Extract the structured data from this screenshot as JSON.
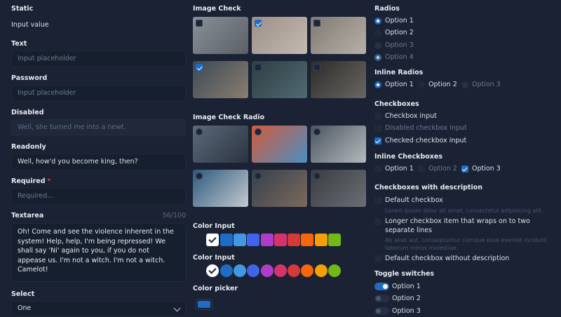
{
  "col1": {
    "static_label": "Static",
    "static_value": "Input value",
    "text_label": "Text",
    "text_placeholder": "Input placeholder",
    "password_label": "Password",
    "password_placeholder": "Input placeholder",
    "disabled_label": "Disabled",
    "disabled_value": "Well, she turned me into a newt.",
    "readonly_label": "Readonly",
    "readonly_value": "Well, how'd you become king, then?",
    "required_label": "Required",
    "required_star": "*",
    "required_placeholder": "Required...",
    "textarea_label": "Textarea",
    "textarea_counter": "56/100",
    "textarea_value": "Oh! Come and see the violence inherent in the system! Help, help, I'm being repressed! We shall say 'Ni' again to you, if you do not appease us. I'm not a witch. I'm not a witch. Camelot!",
    "select_label": "Select",
    "select_value": "One"
  },
  "col2": {
    "image_check_label": "Image Check",
    "image_check_checked": [
      false,
      true,
      false,
      true,
      false,
      false
    ],
    "image_check_colors": [
      [
        "#8a9097",
        "#5a6066"
      ],
      [
        "#9c8f86",
        "#c3bab3"
      ],
      [
        "#7f7a73",
        "#b7b0a7"
      ],
      [
        "#3a4a56",
        "#8b7d6f"
      ],
      [
        "#2e3e44",
        "#506a70"
      ],
      [
        "#2c2b2a",
        "#6b6761"
      ]
    ],
    "image_radio_label": "Image Check Radio",
    "image_radio_checked": [
      false,
      false,
      false,
      false,
      false,
      false
    ],
    "image_radio_colors": [
      [
        "#5d6a7a",
        "#2a3440"
      ],
      [
        "#d35a3a",
        "#4a8fc2"
      ],
      [
        "#4b5560",
        "#b5b9bd"
      ],
      [
        "#2d5a7d",
        "#c4c9cf"
      ],
      [
        "#35404d",
        "#7b6a5c"
      ],
      [
        "#3a3c40",
        "#6a6f75"
      ]
    ],
    "color_input_label_1": "Color Input",
    "color_input_label_2": "Color Input",
    "swatches": [
      "#1a2234",
      "#ffffff",
      "#206bc4",
      "#4299e1",
      "#4263eb",
      "#ae3ec9",
      "#d6336c",
      "#d63939",
      "#f76707",
      "#f59f00",
      "#74b816"
    ],
    "selected_swatch": 1,
    "color_picker_label": "Color picker",
    "color_picker_value": "#206bc4"
  },
  "col3": {
    "radios_label": "Radios",
    "radios": [
      {
        "label": "Option 1",
        "state": "checked"
      },
      {
        "label": "Option 2",
        "state": "unchecked"
      },
      {
        "label": "Option 3",
        "state": "disabled"
      },
      {
        "label": "Option 4",
        "state": "disabled-checked"
      }
    ],
    "inline_radios_label": "Inline Radios",
    "inline_radios": [
      {
        "label": "Option 1",
        "state": "checked"
      },
      {
        "label": "Option 2",
        "state": "unchecked"
      },
      {
        "label": "Option 3",
        "state": "disabled"
      }
    ],
    "checkboxes_label": "Checkboxes",
    "checkboxes": [
      {
        "label": "Checkbox input",
        "state": "unchecked"
      },
      {
        "label": "Disabled checkbox input",
        "state": "disabled"
      },
      {
        "label": "Checked checkbox input",
        "state": "checked"
      }
    ],
    "inline_checkboxes_label": "Inline Checkboxes",
    "inline_checkboxes": [
      {
        "label": "Option 1",
        "state": "unchecked"
      },
      {
        "label": "Option 2",
        "state": "disabled"
      },
      {
        "label": "Option 3",
        "state": "checked"
      }
    ],
    "desc_label": "Checkboxes with description",
    "desc_items": [
      {
        "label": "Default checkbox",
        "desc": "Lorem ipsum dolor sit amet, consectetur adipisicing elit."
      },
      {
        "label": "Longer checkbox item that wraps on to two separate lines",
        "desc": "Ab alias aut, consequuntur cumque esse eveniet incidunt laborum minus molestiae."
      },
      {
        "label": "Default checkbox without description",
        "desc": ""
      }
    ],
    "toggles_label": "Toggle switches",
    "toggles": [
      {
        "label": "Option 1",
        "on": true
      },
      {
        "label": "Option 2",
        "on": false
      },
      {
        "label": "Option 3",
        "on": false
      }
    ]
  }
}
